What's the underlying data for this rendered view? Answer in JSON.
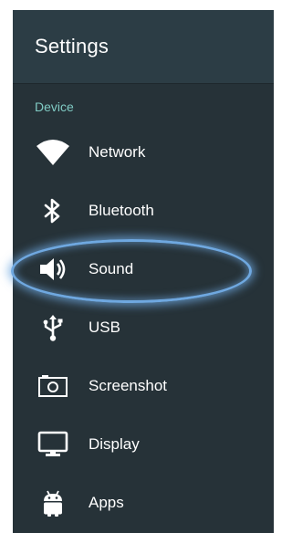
{
  "header": {
    "title": "Settings"
  },
  "section": {
    "label": "Device"
  },
  "items": [
    {
      "label": "Network",
      "icon": "wifi-icon"
    },
    {
      "label": "Bluetooth",
      "icon": "bluetooth-icon"
    },
    {
      "label": "Sound",
      "icon": "speaker-icon"
    },
    {
      "label": "USB",
      "icon": "usb-icon"
    },
    {
      "label": "Screenshot",
      "icon": "screenshot-icon"
    },
    {
      "label": "Display",
      "icon": "monitor-icon"
    },
    {
      "label": "Apps",
      "icon": "android-icon"
    }
  ],
  "colors": {
    "panel": "#263238",
    "header": "#2c3d45",
    "section_accent": "#80cbc4",
    "highlight": "#6fa8e0"
  }
}
